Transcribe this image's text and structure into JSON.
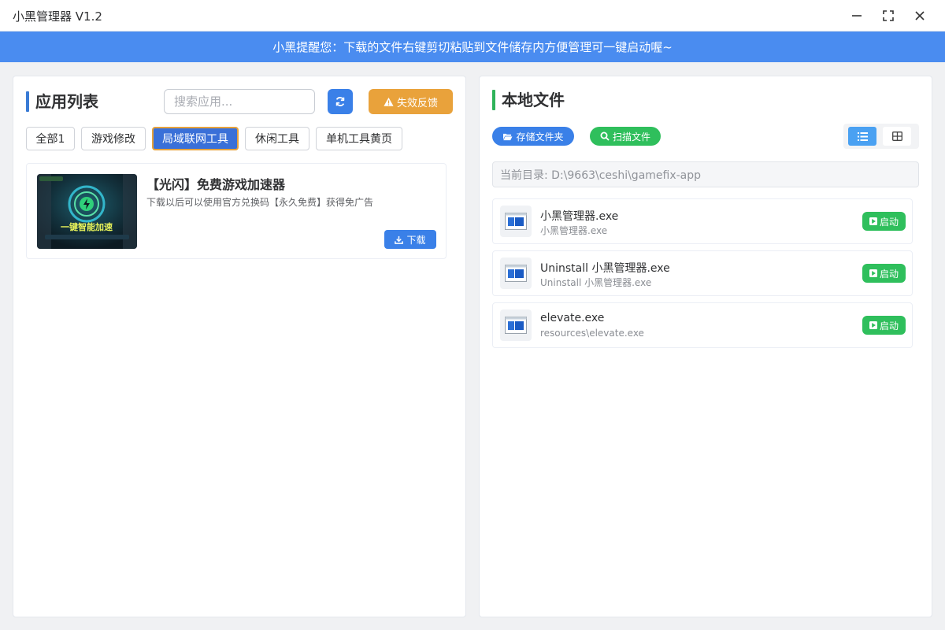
{
  "window": {
    "title": "小黑管理器 V1.2"
  },
  "notice": {
    "text": "小黑提醒您：下载的文件右键剪切粘贴到文件储存内方便管理可一键启动喔~"
  },
  "app_list": {
    "title": "应用列表",
    "search_placeholder": "搜索应用...",
    "feedback_label": "失效反馈",
    "tabs": [
      "全部1",
      "游戏修改",
      "局域联网工具",
      "休闲工具",
      "单机工具黄页"
    ],
    "active_tab": "局域联网工具",
    "apps": [
      {
        "name": "【光闪】免费游戏加速器",
        "description": "下载以后可以使用官方兑换码【永久免费】获得免广告",
        "download_label": "下载",
        "thumbnail_text": "一键智能加速"
      }
    ]
  },
  "local_files": {
    "title": "本地文件",
    "store_folder_label": "存储文件夹",
    "scan_files_label": "扫描文件",
    "current_dir": "当前目录: D:\\9663\\ceshi\\gamefix-app",
    "view_mode": "list",
    "files": [
      {
        "name": "小黑管理器.exe",
        "path": "小黑管理器.exe",
        "launch_label": "启动"
      },
      {
        "name": "Uninstall 小黑管理器.exe",
        "path": "Uninstall 小黑管理器.exe",
        "launch_label": "启动"
      },
      {
        "name": "elevate.exe",
        "path": "resources\\elevate.exe",
        "launch_label": "启动"
      }
    ]
  },
  "colors": {
    "primary": "#3a80e8",
    "notice_bar": "#4a8cf0",
    "success": "#2fbf5c",
    "warning": "#e9a23b",
    "accent_left": "#3a7bd5",
    "accent_right": "#2fb35a"
  }
}
